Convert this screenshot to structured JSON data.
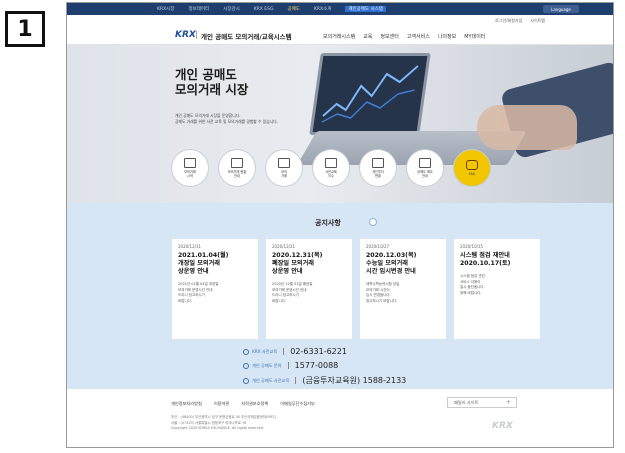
{
  "step_number": "1",
  "topbar": {
    "items": [
      "KRX시장",
      "정보데이터",
      "시장감시",
      "KRX ESG",
      "공매도",
      "KRX소개"
    ],
    "active_index": 4,
    "highlight_label": "개인공매도 시스템",
    "lang_label": "Language"
  },
  "header": {
    "logo": "KRX",
    "site_title": "개인 공매도 모의거래/교육시스템",
    "mini_links": [
      "로그인/회원가입",
      "사이트맵"
    ],
    "nav": [
      "모의거래시스템",
      "교육",
      "정보센터",
      "고객서비스",
      "나의정보",
      "MY데이터"
    ]
  },
  "hero": {
    "title_line1": "개인 공매도",
    "title_line2": "모의거래 시장",
    "desc_line1": "개인 공매도 모의거래 시장을 운영합니다.",
    "desc_line2": "공매도 거래를 위한 사전 교육 및 모의거래를 경험할 수 있습니다."
  },
  "quick_links": [
    {
      "label": "모의거래\n시작",
      "alt": false
    },
    {
      "label": "모의거래 현황\n안내",
      "alt": false
    },
    {
      "label": "모의\n거래",
      "alt": false
    },
    {
      "label": "사전교육\n이수",
      "alt": false
    },
    {
      "label": "개인투자\n현황",
      "alt": false
    },
    {
      "label": "공매도 제도\n안내",
      "alt": false
    },
    {
      "label": "FAQ",
      "alt": true
    }
  ],
  "notice": {
    "title": "공지사항",
    "cards": [
      {
        "date": "2020/12/31",
        "title": "2021.01.04(월)\n개장일 모의거래\n상운영 안내",
        "body": "2021년 01월 04일 개장일\n모의거래 운영시간 안내\n드리니 참고하시기\n바랍니다."
      },
      {
        "date": "2020/12/21",
        "title": "2020.12.31(목)\n폐장일 모의거래\n상운영 안내",
        "body": "2020년 12월 31일 폐장일\n모의거래 운영시간 안내\n드리니 참고하시기\n바랍니다."
      },
      {
        "date": "2020/10/27",
        "title": "2020.12.03(목)\n수능일 모의거래\n시간 임시변경 안내",
        "body": "대학수학능력시험 당일\n모의거래 시간이\n임시 변경됩니다.\n참고하시기 바랍니다."
      },
      {
        "date": "2020/10/15",
        "title": "시스템 점검 재안내\n2020.10.17(토)",
        "body": "시스템 점검 관련\n서비스 이용이\n일시 중단됩니다.\n양해 바랍니다."
      }
    ]
  },
  "contacts": [
    {
      "label": "KRX 사전교육",
      "number": "02-6331-6221"
    },
    {
      "label": "개인 공매도 문의",
      "number": "1577-0088"
    },
    {
      "label": "개인 공매도 사전교육",
      "number": "(금융투자교육원) 1588-2133"
    }
  ],
  "footer": {
    "links": [
      "개인정보처리방침",
      "이용약관",
      "저작권보호정책",
      "이메일무단수집거부"
    ],
    "family_site": "패밀리 사이트",
    "address_line1": "부산 : (48400) 부산광역시 남구 문현금융로 40 부산국제금융센터(BIFC)",
    "address_line2": "서울 : (07329) 서울특별시 영등포구 여의나루로 76",
    "address_line3": "Copyright 2020 KOREA EXCHANGE. All rights reserved.",
    "footer_logo": "KRX"
  }
}
